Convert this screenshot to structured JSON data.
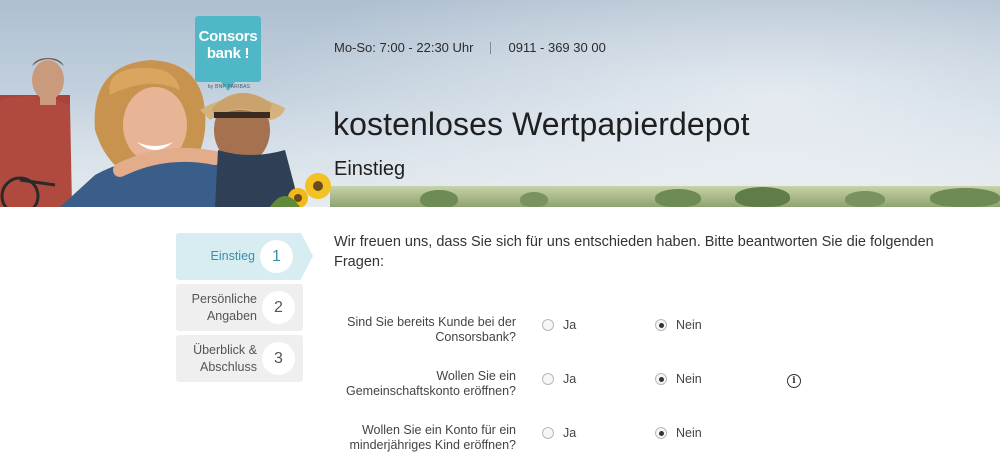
{
  "brand": {
    "logo_line1": "Consors",
    "logo_line2": "bank !",
    "logo_byline": "by BNP PARIBAS",
    "accent_color": "#4fb7c5"
  },
  "header": {
    "hours": "Mo-So: 7:00 - 22:30 Uhr",
    "phone": "0911 - 369 30 00",
    "title": "kostenloses Wertpapierdepot",
    "subtitle": "Einstieg"
  },
  "steps": [
    {
      "label": "Einstieg",
      "number": "1",
      "active": true
    },
    {
      "label_line1": "Persönliche",
      "label_line2": "Angaben",
      "number": "2",
      "active": false
    },
    {
      "label_line1": "Überblick &",
      "label_line2": "Abschluss",
      "number": "3",
      "active": false
    }
  ],
  "intro": "Wir freuen uns, dass Sie sich für uns entschieden haben. Bitte beantworten Sie die folgenden Fragen:",
  "questions": [
    {
      "line1": "Sind Sie bereits Kunde bei der",
      "line2": "Consorsbank?",
      "yes": "Ja",
      "no": "Nein",
      "selected": "no",
      "info_icon": false
    },
    {
      "line1": "Wollen Sie ein",
      "line2": "Gemeinschaftskonto eröffnen?",
      "yes": "Ja",
      "no": "Nein",
      "selected": "no",
      "info_icon": true
    },
    {
      "line1": "Wollen Sie ein Konto für ein",
      "line2": "minderjähriges Kind eröffnen?",
      "yes": "Ja",
      "no": "Nein",
      "selected": "no",
      "info_icon": false
    }
  ],
  "info_icon_glyph": "i"
}
